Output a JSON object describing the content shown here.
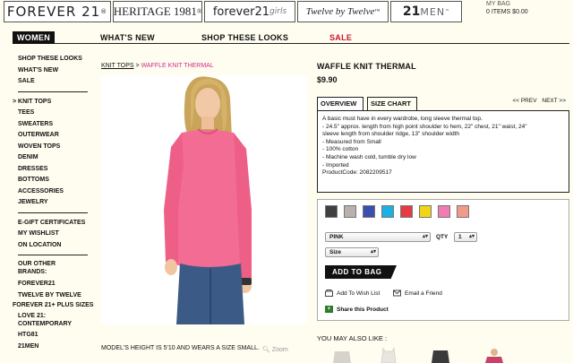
{
  "brands": {
    "forever21": "FOREVER 21",
    "forever21_mark": "®",
    "heritage": "HERITAGE 1981",
    "heritage_mark": "®",
    "f21girls": "forever21",
    "f21girls_suffix": "girls",
    "twelve": "Twelve by Twelve",
    "twelve_mark": "™",
    "men_num": "21",
    "men_word": "MEN",
    "men_mark": "™"
  },
  "bag": {
    "label": "MY BAG",
    "items": "0 ITEMS $0.00"
  },
  "nav": {
    "women": "WOMEN",
    "whats_new": "WHAT'S NEW",
    "looks": "SHOP THESE LOOKS",
    "sale": "SALE"
  },
  "sidebar": {
    "top": [
      "SHOP THESE LOOKS",
      "WHAT'S NEW",
      "SALE"
    ],
    "arrow": ">",
    "categories": [
      "KNIT TOPS",
      "TEES",
      "SWEATERS",
      "OUTERWEAR",
      "WOVEN TOPS",
      "DENIM",
      "DRESSES",
      "BOTTOMS",
      "ACCESSORIES",
      "JEWELRY"
    ],
    "links": [
      "E-GIFT CERTIFICATES",
      "MY WISHLIST",
      "ON LOCATION"
    ],
    "brands_title": "OUR OTHER BRANDS:",
    "brands": [
      "FOREVER21",
      "TWELVE BY TWELVE",
      "FOREVER 21+ PLUS SIZES",
      "LOVE 21: CONTEMPORARY",
      "HTG81",
      "21MEN"
    ]
  },
  "breadcrumb": {
    "parent": "KNIT TOPS",
    "sep": ">",
    "current": "WAFFLE KNIT THERMAL"
  },
  "product": {
    "title": "WAFFLE KNIT THERMAL",
    "price": "$9.90",
    "tab_overview": "OVERVIEW",
    "tab_size": "SIZE CHART",
    "prev": "<< PREV",
    "next": "NEXT >>",
    "description": [
      "A basic must have in every wardrobe, long sleeve thermal top.",
      "- 24.5\" approx. length from high point shoulder to hem, 22\" chest, 21\" waist, 24\"",
      "sleeve length from shoulder ridge, 13\" shoulder width",
      "- Measured from Small",
      "- 100% cotton",
      "- Machine wash cold, tumble dry low",
      "- Imported",
      "ProductCode: 2082209517"
    ],
    "swatch_colors": [
      "#404040",
      "#b8b1ae",
      "#3a4fae",
      "#1db0e3",
      "#e63a46",
      "#f0d51a",
      "#f07bb5",
      "#f19a8a"
    ],
    "color_value": "PINK",
    "qty_label": "QTY",
    "qty_value": "1",
    "size_value": "Size",
    "add_to_bag": "ADD TO BAG",
    "wishlist": "Add To Wish List",
    "email": "Email a Friend",
    "share": "Share this Product",
    "model_caption": "MODEL'S HEIGHT IS 5'10 AND WEARS A SIZE SMALL.",
    "zoom": "Zoom",
    "ymal": "YOU MAY ALSO LIKE :"
  }
}
